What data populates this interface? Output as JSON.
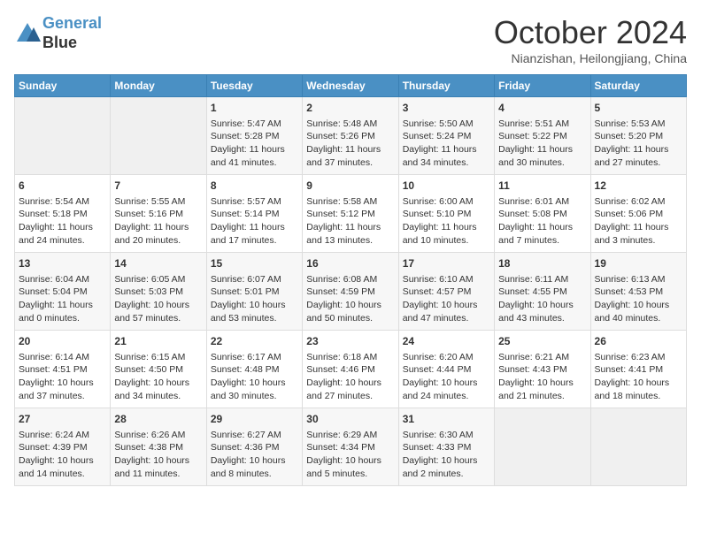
{
  "header": {
    "logo_line1": "General",
    "logo_line2": "Blue",
    "month": "October 2024",
    "location": "Nianzishan, Heilongjiang, China"
  },
  "weekdays": [
    "Sunday",
    "Monday",
    "Tuesday",
    "Wednesday",
    "Thursday",
    "Friday",
    "Saturday"
  ],
  "weeks": [
    [
      {
        "day": "",
        "text": ""
      },
      {
        "day": "",
        "text": ""
      },
      {
        "day": "1",
        "text": "Sunrise: 5:47 AM\nSunset: 5:28 PM\nDaylight: 11 hours and 41 minutes."
      },
      {
        "day": "2",
        "text": "Sunrise: 5:48 AM\nSunset: 5:26 PM\nDaylight: 11 hours and 37 minutes."
      },
      {
        "day": "3",
        "text": "Sunrise: 5:50 AM\nSunset: 5:24 PM\nDaylight: 11 hours and 34 minutes."
      },
      {
        "day": "4",
        "text": "Sunrise: 5:51 AM\nSunset: 5:22 PM\nDaylight: 11 hours and 30 minutes."
      },
      {
        "day": "5",
        "text": "Sunrise: 5:53 AM\nSunset: 5:20 PM\nDaylight: 11 hours and 27 minutes."
      }
    ],
    [
      {
        "day": "6",
        "text": "Sunrise: 5:54 AM\nSunset: 5:18 PM\nDaylight: 11 hours and 24 minutes."
      },
      {
        "day": "7",
        "text": "Sunrise: 5:55 AM\nSunset: 5:16 PM\nDaylight: 11 hours and 20 minutes."
      },
      {
        "day": "8",
        "text": "Sunrise: 5:57 AM\nSunset: 5:14 PM\nDaylight: 11 hours and 17 minutes."
      },
      {
        "day": "9",
        "text": "Sunrise: 5:58 AM\nSunset: 5:12 PM\nDaylight: 11 hours and 13 minutes."
      },
      {
        "day": "10",
        "text": "Sunrise: 6:00 AM\nSunset: 5:10 PM\nDaylight: 11 hours and 10 minutes."
      },
      {
        "day": "11",
        "text": "Sunrise: 6:01 AM\nSunset: 5:08 PM\nDaylight: 11 hours and 7 minutes."
      },
      {
        "day": "12",
        "text": "Sunrise: 6:02 AM\nSunset: 5:06 PM\nDaylight: 11 hours and 3 minutes."
      }
    ],
    [
      {
        "day": "13",
        "text": "Sunrise: 6:04 AM\nSunset: 5:04 PM\nDaylight: 11 hours and 0 minutes."
      },
      {
        "day": "14",
        "text": "Sunrise: 6:05 AM\nSunset: 5:03 PM\nDaylight: 10 hours and 57 minutes."
      },
      {
        "day": "15",
        "text": "Sunrise: 6:07 AM\nSunset: 5:01 PM\nDaylight: 10 hours and 53 minutes."
      },
      {
        "day": "16",
        "text": "Sunrise: 6:08 AM\nSunset: 4:59 PM\nDaylight: 10 hours and 50 minutes."
      },
      {
        "day": "17",
        "text": "Sunrise: 6:10 AM\nSunset: 4:57 PM\nDaylight: 10 hours and 47 minutes."
      },
      {
        "day": "18",
        "text": "Sunrise: 6:11 AM\nSunset: 4:55 PM\nDaylight: 10 hours and 43 minutes."
      },
      {
        "day": "19",
        "text": "Sunrise: 6:13 AM\nSunset: 4:53 PM\nDaylight: 10 hours and 40 minutes."
      }
    ],
    [
      {
        "day": "20",
        "text": "Sunrise: 6:14 AM\nSunset: 4:51 PM\nDaylight: 10 hours and 37 minutes."
      },
      {
        "day": "21",
        "text": "Sunrise: 6:15 AM\nSunset: 4:50 PM\nDaylight: 10 hours and 34 minutes."
      },
      {
        "day": "22",
        "text": "Sunrise: 6:17 AM\nSunset: 4:48 PM\nDaylight: 10 hours and 30 minutes."
      },
      {
        "day": "23",
        "text": "Sunrise: 6:18 AM\nSunset: 4:46 PM\nDaylight: 10 hours and 27 minutes."
      },
      {
        "day": "24",
        "text": "Sunrise: 6:20 AM\nSunset: 4:44 PM\nDaylight: 10 hours and 24 minutes."
      },
      {
        "day": "25",
        "text": "Sunrise: 6:21 AM\nSunset: 4:43 PM\nDaylight: 10 hours and 21 minutes."
      },
      {
        "day": "26",
        "text": "Sunrise: 6:23 AM\nSunset: 4:41 PM\nDaylight: 10 hours and 18 minutes."
      }
    ],
    [
      {
        "day": "27",
        "text": "Sunrise: 6:24 AM\nSunset: 4:39 PM\nDaylight: 10 hours and 14 minutes."
      },
      {
        "day": "28",
        "text": "Sunrise: 6:26 AM\nSunset: 4:38 PM\nDaylight: 10 hours and 11 minutes."
      },
      {
        "day": "29",
        "text": "Sunrise: 6:27 AM\nSunset: 4:36 PM\nDaylight: 10 hours and 8 minutes."
      },
      {
        "day": "30",
        "text": "Sunrise: 6:29 AM\nSunset: 4:34 PM\nDaylight: 10 hours and 5 minutes."
      },
      {
        "day": "31",
        "text": "Sunrise: 6:30 AM\nSunset: 4:33 PM\nDaylight: 10 hours and 2 minutes."
      },
      {
        "day": "",
        "text": ""
      },
      {
        "day": "",
        "text": ""
      }
    ]
  ]
}
